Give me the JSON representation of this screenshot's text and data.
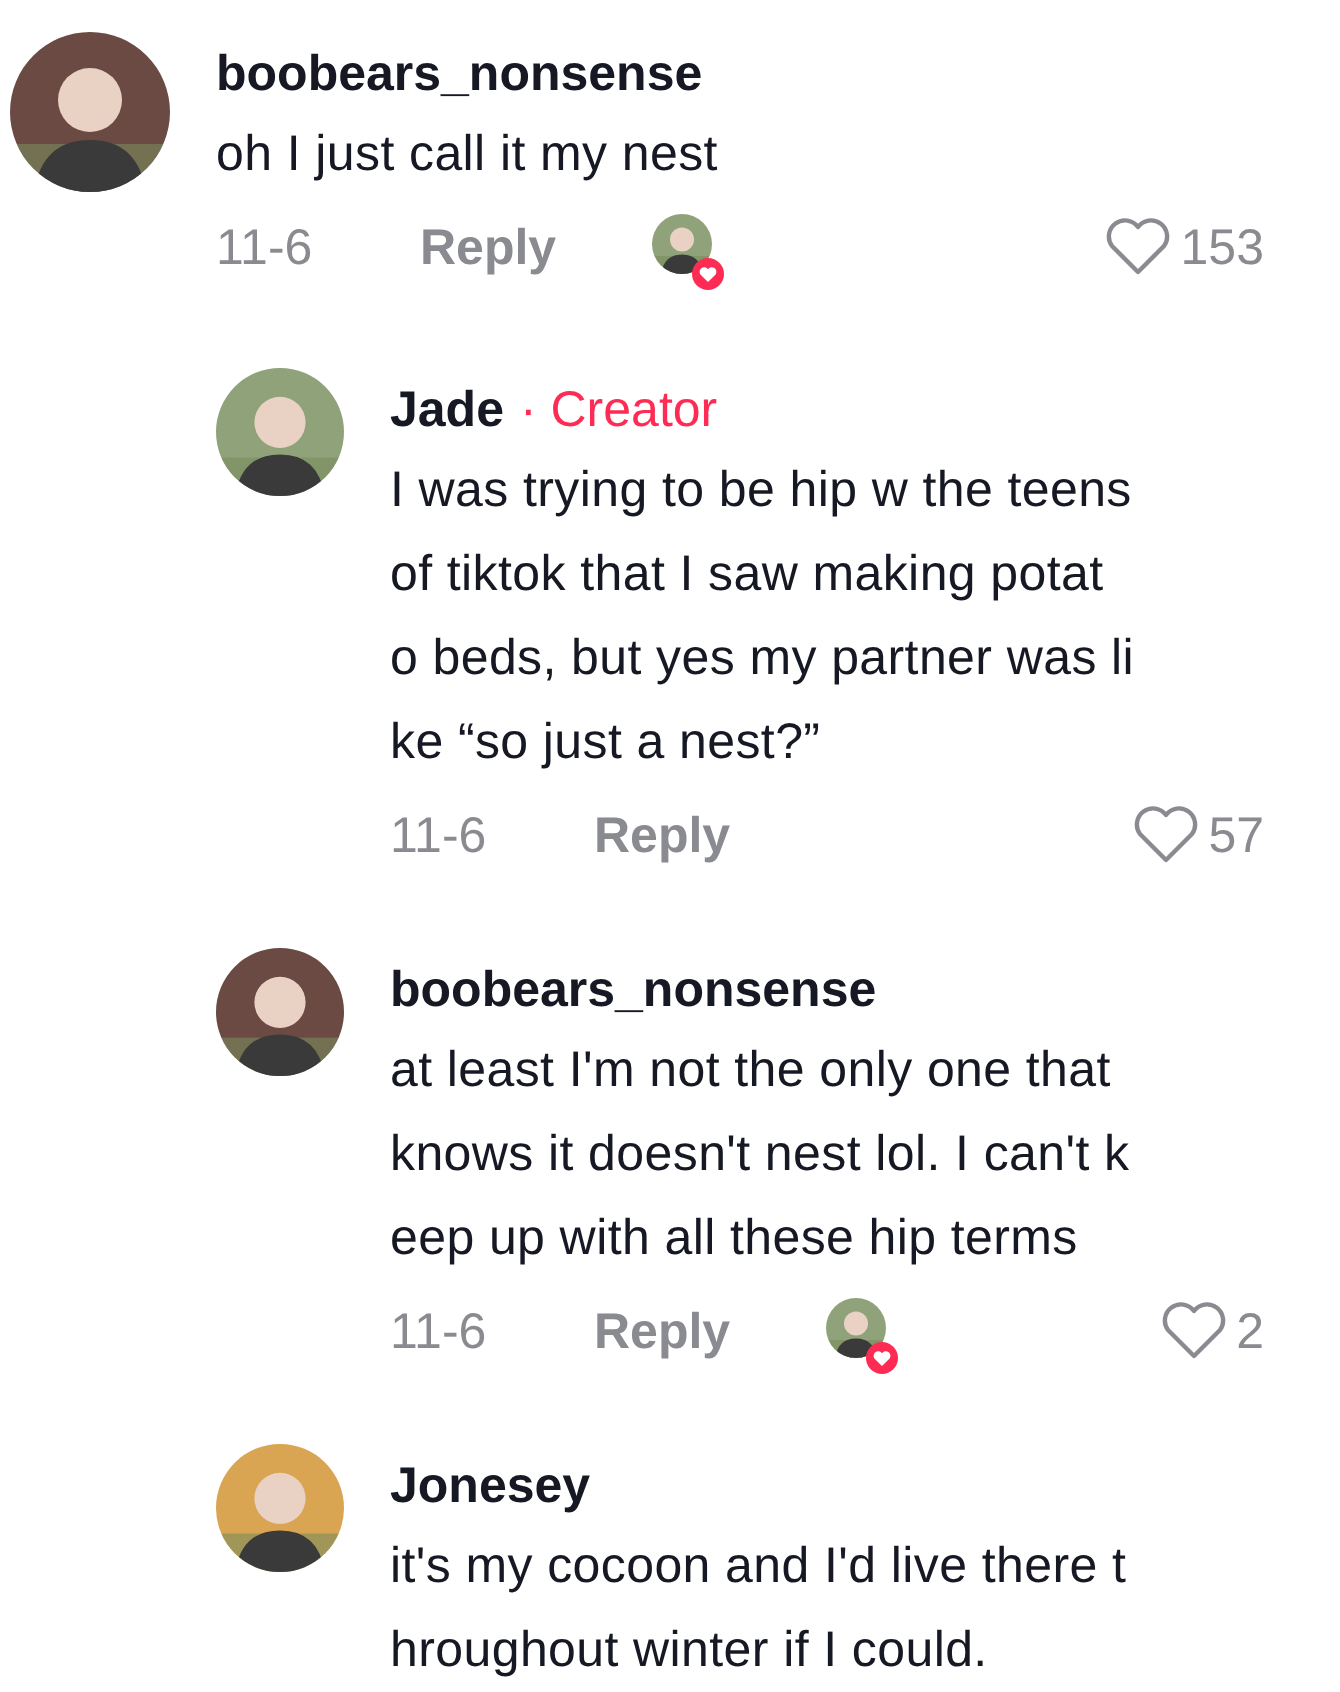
{
  "comments": [
    {
      "name": "boobears_nonsense",
      "lines": [
        "oh I just call it my nest"
      ],
      "date": "11-6",
      "reply_label": "Reply",
      "creator_liked": true,
      "likes": "153",
      "children": [
        {
          "name": "Jade",
          "creator_label": "· Creator",
          "lines": [
            "I was trying to be hip w the teens",
            "of tiktok that I saw making potat",
            "o beds, but yes my partner was li",
            "ke “so just a nest?”"
          ],
          "date": "11-6",
          "reply_label": "Reply",
          "creator_liked": false,
          "likes": "57"
        },
        {
          "name": "boobears_nonsense",
          "lines": [
            "at least I'm not the only one that",
            "knows it doesn't nest lol. I can't k",
            "eep up with all these hip terms"
          ],
          "date": "11-6",
          "reply_label": "Reply",
          "creator_liked": true,
          "likes": "2"
        },
        {
          "name": "Jonesey",
          "lines": [
            "it's my cocoon and I'd live there t",
            "hroughout winter if I could."
          ]
        }
      ]
    }
  ]
}
